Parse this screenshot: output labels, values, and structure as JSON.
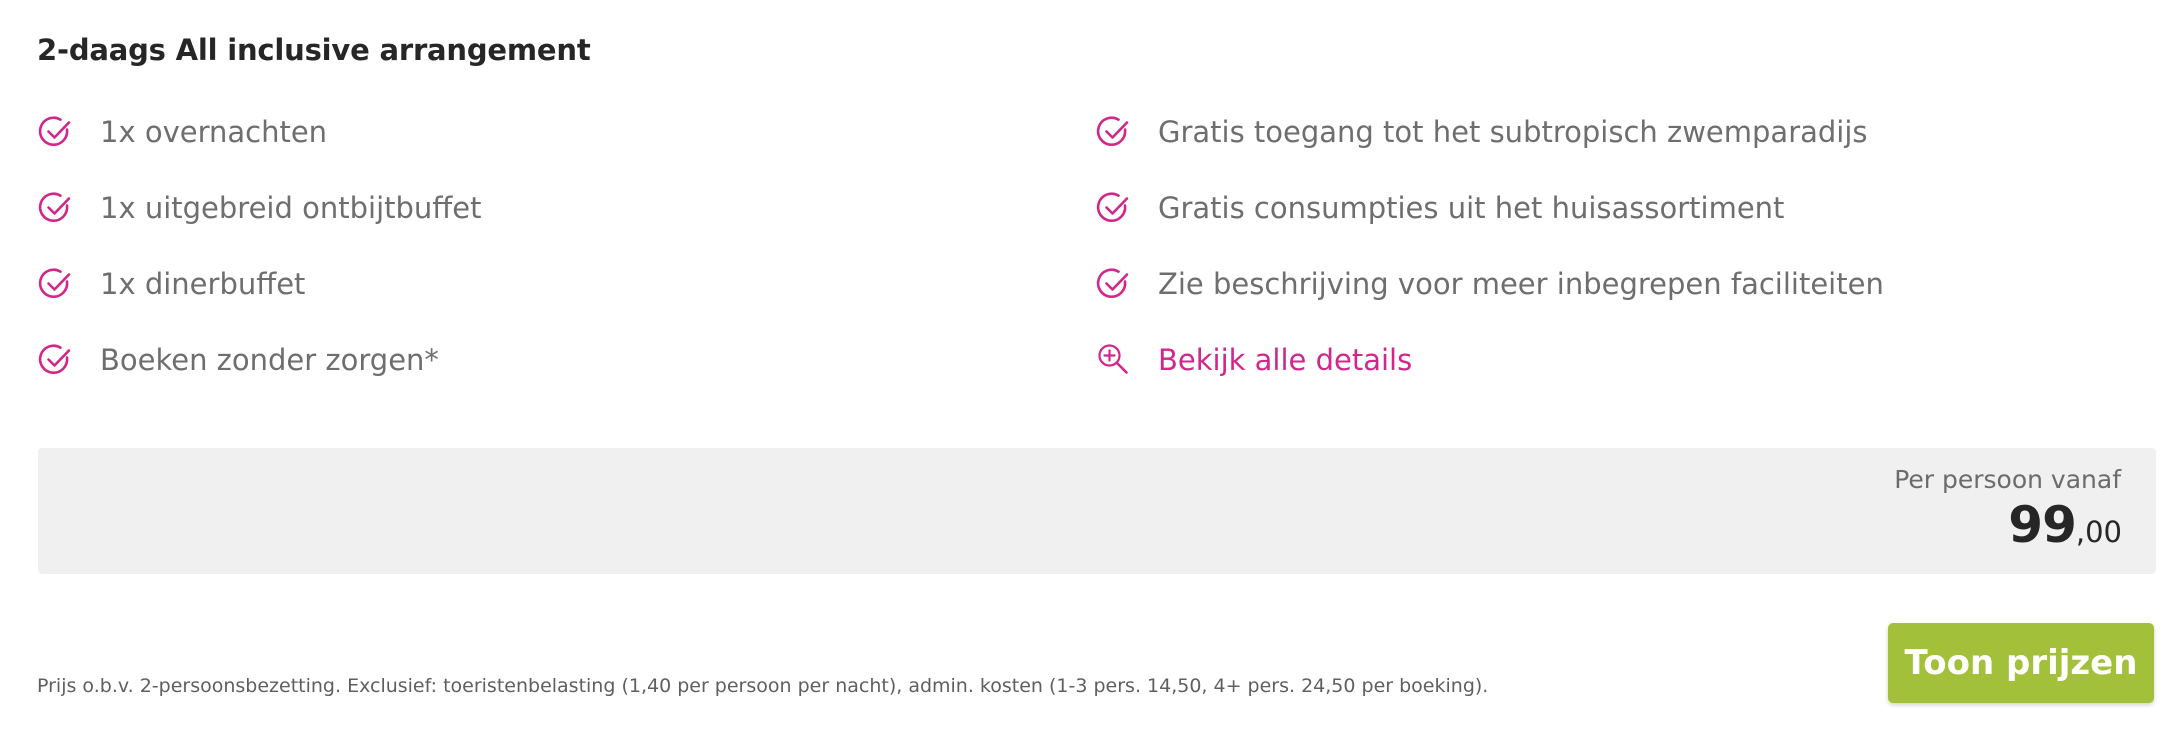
{
  "package": {
    "title": "2-daags All inclusive arrangement"
  },
  "features": {
    "left": [
      {
        "label": "1x overnachten",
        "icon": "check-circle-icon"
      },
      {
        "label": "1x uitgebreid ontbijtbuffet",
        "icon": "check-circle-icon"
      },
      {
        "label": "1x dinerbuffet",
        "icon": "check-circle-icon"
      },
      {
        "label": "Boeken zonder zorgen*",
        "icon": "check-circle-icon"
      }
    ],
    "right": [
      {
        "label": "Gratis toegang tot het subtropisch zwemparadijs",
        "icon": "check-circle-icon"
      },
      {
        "label": "Gratis consumpties uit het huisassortiment",
        "icon": "check-circle-icon"
      },
      {
        "label": "Zie beschrijving voor meer inbegrepen faciliteiten",
        "icon": "check-circle-icon"
      }
    ],
    "details_link": {
      "label": "Bekijk alle details",
      "icon": "zoom-in-icon"
    }
  },
  "price": {
    "caption": "Per persoon vanaf",
    "amount": "99",
    "cents": ",00"
  },
  "footnote": "Prijs o.b.v. 2-persoonsbezetting. Exclusief: toeristenbelasting (1,40 per persoon per nacht), admin. kosten (1-3 pers. 14,50, 4+ pers. 24,50 per boeking).",
  "cta": {
    "label": "Toon prijzen"
  },
  "colors": {
    "accent_magenta": "#d1278a",
    "button_green": "#a3c03a",
    "price_box_bg": "#f0f0f0",
    "title_text": "#262626",
    "body_text": "#6e6e6e"
  }
}
